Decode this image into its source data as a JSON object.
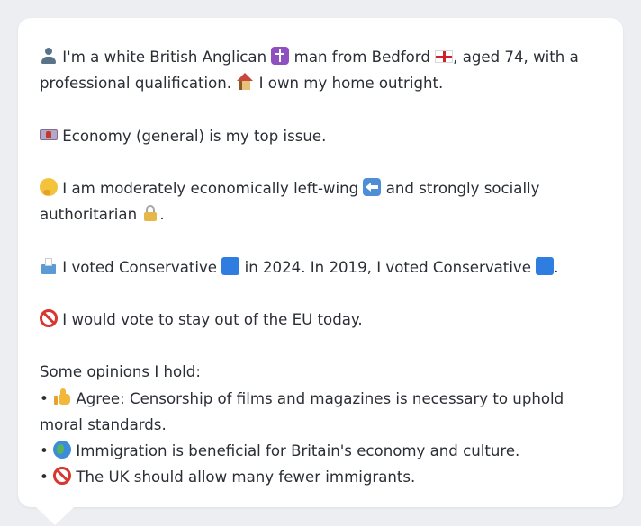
{
  "profile": {
    "intro": {
      "part1": "I'm a white British Anglican",
      "part2": "man from Bedford",
      "part3": ", aged 74, with a professional qualification.",
      "part4": "I own my home outright."
    },
    "top_issue": "Economy (general) is my top issue.",
    "economics": {
      "part1": "I am moderately economically left-wing",
      "part2": "and strongly socially authoritarian",
      "part3": "."
    },
    "votes": {
      "part1": "I voted Conservative",
      "part2": "in 2024. In 2019, I voted Conservative",
      "part3": "."
    },
    "eu_stance": "I would vote to stay out of the EU today.",
    "opinions_heading": "Some opinions I hold:",
    "opinions": [
      {
        "bullet": "•",
        "text": "Agree: Censorship of films and magazines is necessary to uphold moral standards."
      },
      {
        "bullet": "•",
        "text": "Immigration is beneficial for Britain's economy and culture."
      },
      {
        "bullet": "•",
        "text": "The UK should allow many fewer immigrants."
      }
    ]
  },
  "icons": {
    "person": "person-icon",
    "religion": "latin-cross-icon",
    "flag": "england-flag-icon",
    "home": "house-icon",
    "issue": "banknote-icon",
    "economics": "thinking-face-icon",
    "direction": "left-arrow-icon",
    "social": "lock-icon",
    "vote": "ballot-box-icon",
    "party": "blue-square-icon",
    "eu": "prohibited-icon",
    "agree": "thumbs-up-icon",
    "globe": "globe-icon",
    "opposed": "prohibited-icon"
  },
  "colors": {
    "background": "#eceef1",
    "bubble": "#ffffff",
    "text": "#2a2e35",
    "conservative_blue": "#2f7de1"
  }
}
